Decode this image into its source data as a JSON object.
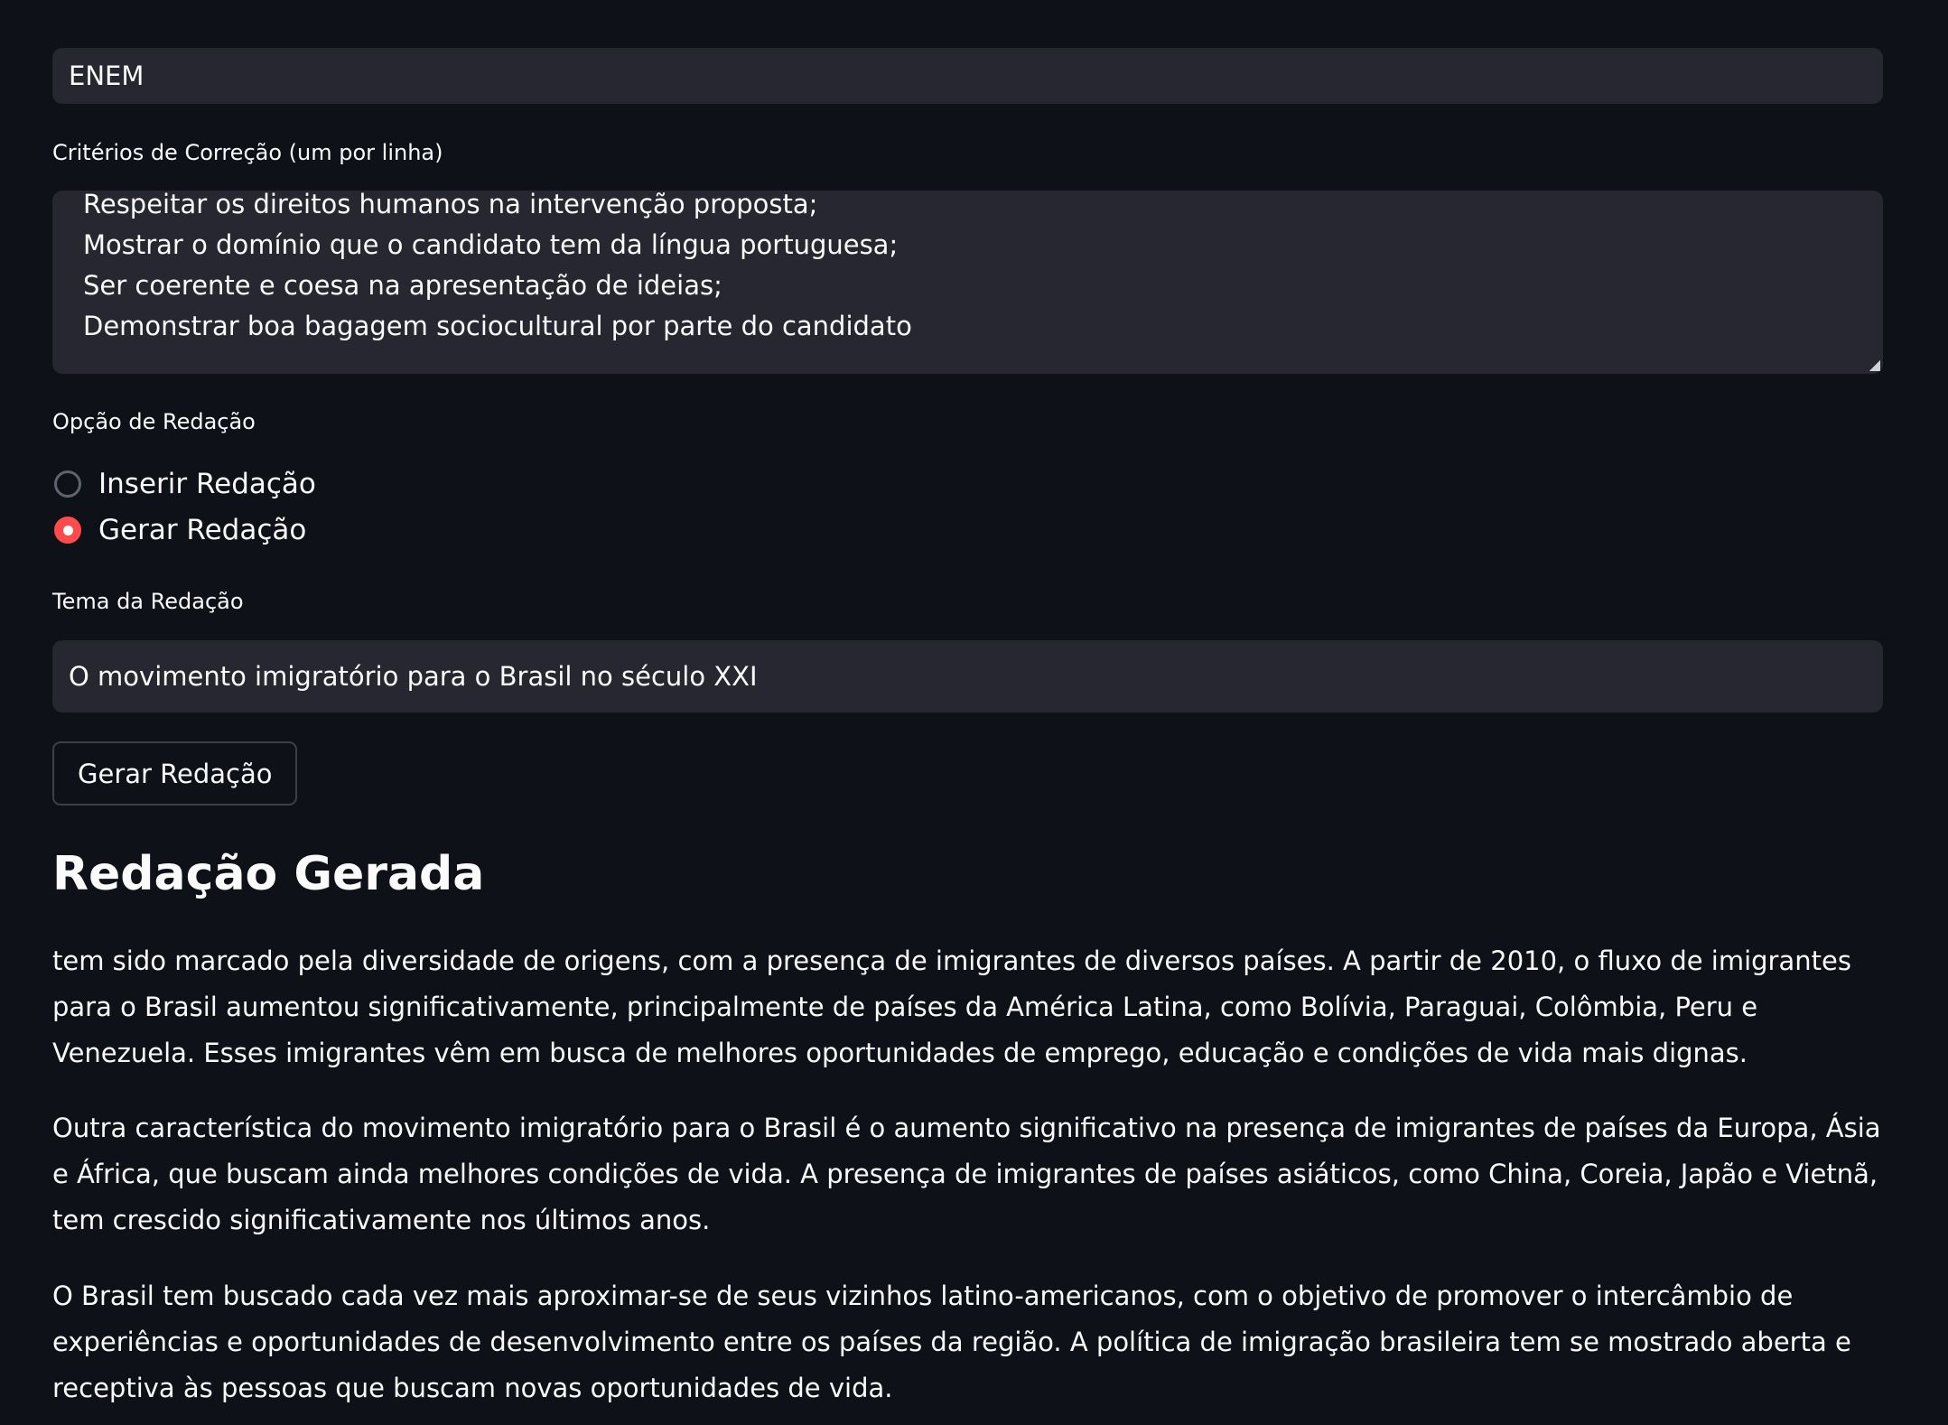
{
  "exam_type": {
    "value": "ENEM"
  },
  "criteria": {
    "label": "Critérios de Correção (um por linha)",
    "visible_lines": [
      "Respeitar os direitos humanos na intervenção proposta;",
      "Mostrar o domínio que o candidato tem da língua portuguesa;",
      "Ser coerente e coesa na apresentação de ideias;",
      "Demonstrar boa bagagem sociocultural por parte do candidato"
    ]
  },
  "essay_option": {
    "label": "Opção de Redação",
    "options": [
      {
        "label": "Inserir Redação",
        "selected": false
      },
      {
        "label": "Gerar Redação",
        "selected": true
      }
    ]
  },
  "theme": {
    "label": "Tema da Redação",
    "value": "O movimento imigratório para o Brasil no século XXI"
  },
  "generate_button": {
    "label": "Gerar Redação"
  },
  "result": {
    "heading": "Redação Gerada",
    "paragraphs": [
      "tem sido marcado pela diversidade de origens, com a presença de imigrantes de diversos países. A partir de 2010, o fluxo de imigrantes para o Brasil aumentou significativamente, principalmente de países da América Latina, como Bolívia, Paraguai, Colômbia, Peru e Venezuela. Esses imigrantes vêm em busca de melhores oportunidades de emprego, educação e condições de vida mais dignas.",
      "Outra característica do movimento imigratório para o Brasil é o aumento significativo na presença de imigrantes de países da Europa, Ásia e África, que buscam ainda melhores condições de vida. A presença de imigrantes de países asiáticos, como China, Coreia, Japão e Vietnã, tem crescido significativamente nos últimos anos.",
      "O Brasil tem buscado cada vez mais aproximar-se de seus vizinhos latino-americanos, com o objetivo de promover o intercâmbio de experiências e oportunidades de desenvolvimento entre os países da região. A política de imigração brasileira tem se mostrado aberta e receptiva às pessoas que buscam novas oportunidades de vida."
    ]
  },
  "colors": {
    "background": "#0e1117",
    "input_background": "#262730",
    "accent": "#ff4b4b",
    "text": "#fafafa"
  }
}
